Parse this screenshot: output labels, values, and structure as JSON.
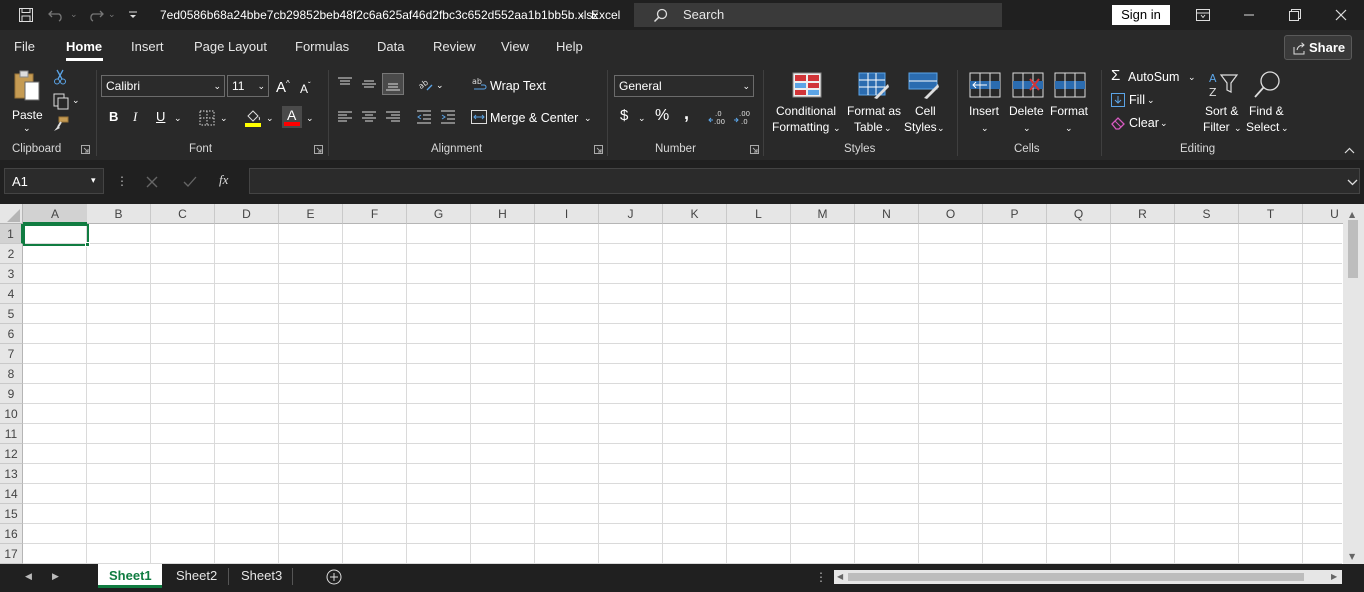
{
  "titlebar": {
    "filename": "7ed0586b68a24bbe7cb29852beb48f2c6a625af46d2fbc3c652d552aa1b1bb5b.xlsx",
    "separator": "-",
    "app": "Excel",
    "search_placeholder": "Search",
    "sign_in": "Sign in"
  },
  "tabs": [
    "File",
    "Home",
    "Insert",
    "Page Layout",
    "Formulas",
    "Data",
    "Review",
    "View",
    "Help"
  ],
  "active_tab": "Home",
  "share_label": "Share",
  "ribbon": {
    "clipboard": {
      "paste": "Paste",
      "label": "Clipboard"
    },
    "font": {
      "name": "Calibri",
      "size": "11",
      "label": "Font",
      "bold": "B",
      "italic": "I",
      "underline": "U",
      "grow": "A^",
      "shrink": "Aˇ",
      "font_color": "A"
    },
    "alignment": {
      "wrap": "Wrap Text",
      "merge": "Merge & Center",
      "label": "Alignment"
    },
    "number": {
      "format": "General",
      "currency": "$",
      "percent": "%",
      "comma": ",",
      "label": "Number"
    },
    "styles": {
      "conditional_1": "Conditional",
      "conditional_2": "Formatting",
      "format_table_1": "Format as",
      "format_table_2": "Table",
      "cell_styles_1": "Cell",
      "cell_styles_2": "Styles",
      "label": "Styles"
    },
    "cells": {
      "insert": "Insert",
      "delete": "Delete",
      "format": "Format",
      "label": "Cells"
    },
    "editing": {
      "autosum": "AutoSum",
      "fill": "Fill",
      "clear": "Clear",
      "sort_1": "Sort &",
      "sort_2": "Filter",
      "find_1": "Find &",
      "find_2": "Select",
      "label": "Editing"
    }
  },
  "formula_bar": {
    "name_box": "A1",
    "fx": "fx",
    "formula": ""
  },
  "grid": {
    "columns": [
      "A",
      "B",
      "C",
      "D",
      "E",
      "F",
      "G",
      "H",
      "I",
      "J",
      "K",
      "L",
      "M",
      "N",
      "O",
      "P",
      "Q",
      "R",
      "S",
      "T",
      "U"
    ],
    "rows": [
      "1",
      "2",
      "3",
      "4",
      "5",
      "6",
      "7",
      "8",
      "9",
      "10",
      "11",
      "12",
      "13",
      "14",
      "15",
      "16",
      "17"
    ],
    "selected_cell": "A1"
  },
  "sheets": [
    "Sheet1",
    "Sheet2",
    "Sheet3"
  ],
  "active_sheet": "Sheet1",
  "colors": {
    "accent": "#107c41",
    "ribbon_bg": "#292929",
    "title_bg": "#202020",
    "grid_line": "#d4d4d4",
    "fill_highlight": "#ffff00",
    "font_red": "#ff0000"
  }
}
